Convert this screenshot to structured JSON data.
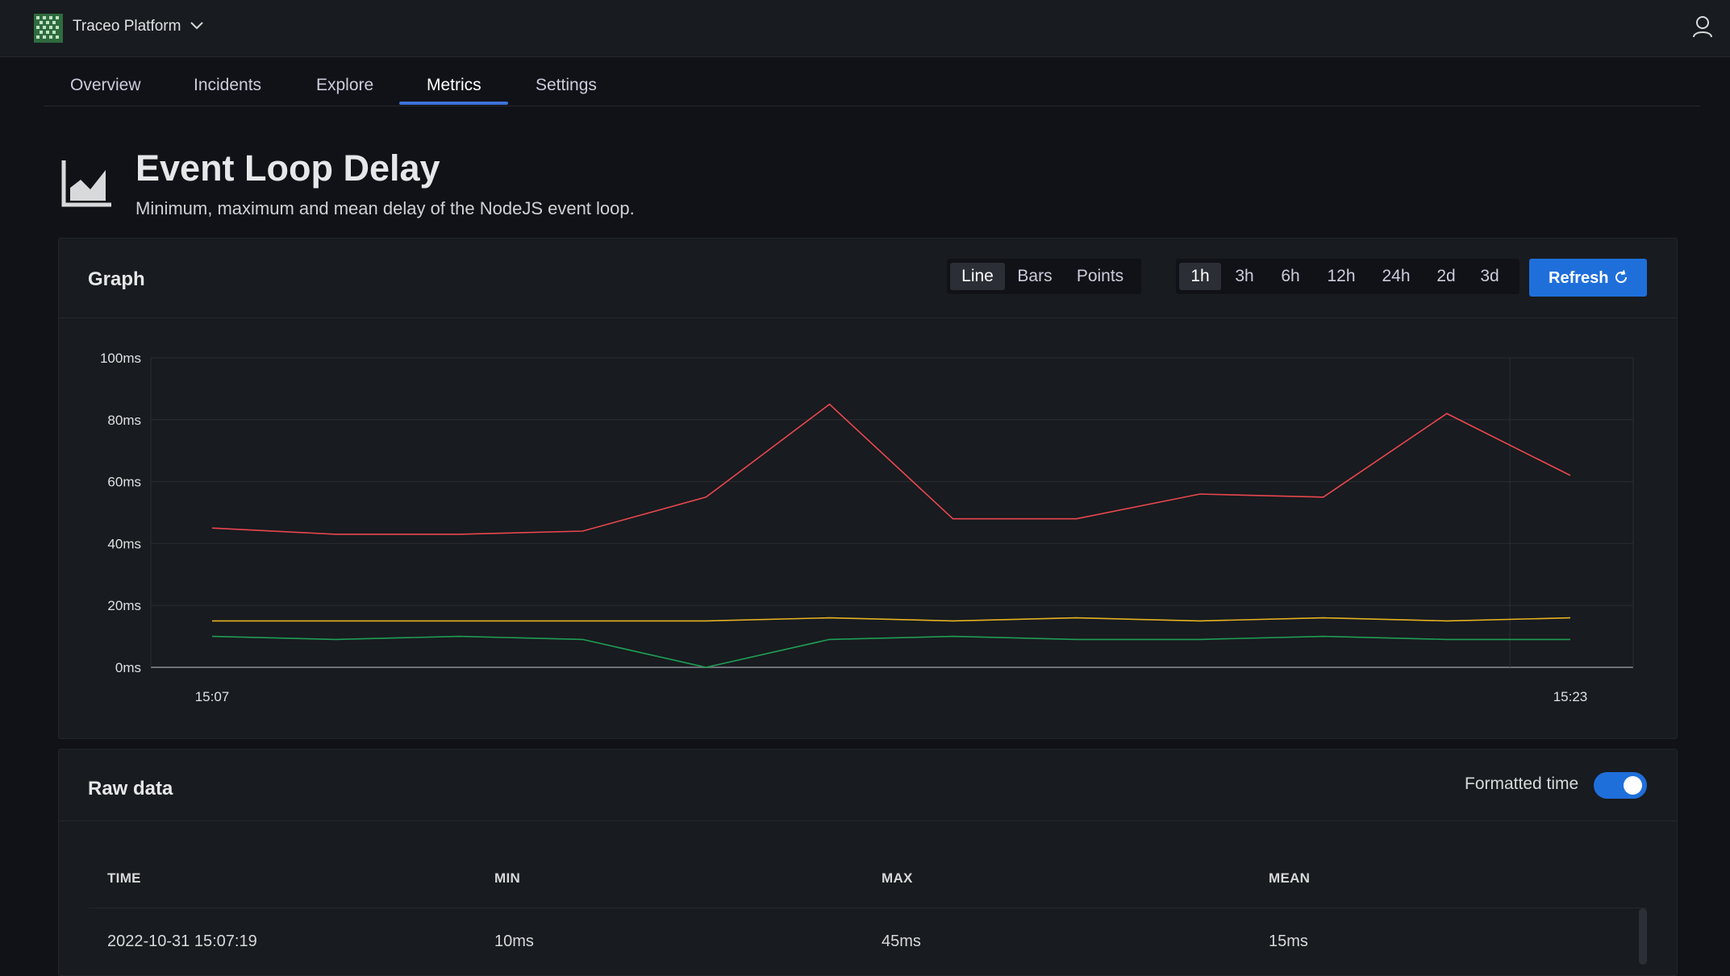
{
  "app": {
    "title": "Traceo Platform"
  },
  "tabs": [
    {
      "label": "Overview"
    },
    {
      "label": "Incidents"
    },
    {
      "label": "Explore"
    },
    {
      "label": "Metrics",
      "active": true
    },
    {
      "label": "Settings"
    }
  ],
  "page": {
    "title": "Event Loop Delay",
    "subtitle": "Minimum, maximum and mean delay of the NodeJS event loop."
  },
  "graph_panel": {
    "title": "Graph",
    "chart_types": [
      "Line",
      "Bars",
      "Points"
    ],
    "selected_chart_type": "Line",
    "ranges": [
      "1h",
      "3h",
      "6h",
      "12h",
      "24h",
      "2d",
      "3d"
    ],
    "selected_range": "1h",
    "refresh_label": "Refresh"
  },
  "colors": {
    "accent": "#1f6fdb",
    "max": "#e8474f",
    "mean": "#e5b222",
    "min": "#1f9d55"
  },
  "chart_data": {
    "type": "line",
    "x_tick_labels": [
      "15:07",
      "15:23"
    ],
    "ytick_labels": [
      "0ms",
      "20ms",
      "40ms",
      "60ms",
      "80ms",
      "100ms"
    ],
    "ylim": [
      0,
      100
    ],
    "grid": true,
    "series": [
      {
        "key": "max",
        "color": "#e8474f",
        "values": [
          45,
          43,
          43,
          44,
          55,
          85,
          48,
          48,
          56,
          55,
          82,
          62
        ]
      },
      {
        "key": "mean",
        "color": "#e5b222",
        "values": [
          15,
          15,
          15,
          15,
          15,
          16,
          15,
          16,
          15,
          16,
          15,
          16
        ]
      },
      {
        "key": "min",
        "color": "#1f9d55",
        "values": [
          10,
          9,
          10,
          9,
          0,
          9,
          10,
          9,
          9,
          10,
          9,
          9
        ]
      }
    ]
  },
  "raw_panel": {
    "title": "Raw data",
    "toggle_label": "Formatted time",
    "toggle_on": true,
    "columns": [
      "TIME",
      "MIN",
      "MAX",
      "MEAN"
    ],
    "rows": [
      [
        "2022-10-31 15:07:19",
        "10ms",
        "45ms",
        "15ms"
      ]
    ]
  }
}
